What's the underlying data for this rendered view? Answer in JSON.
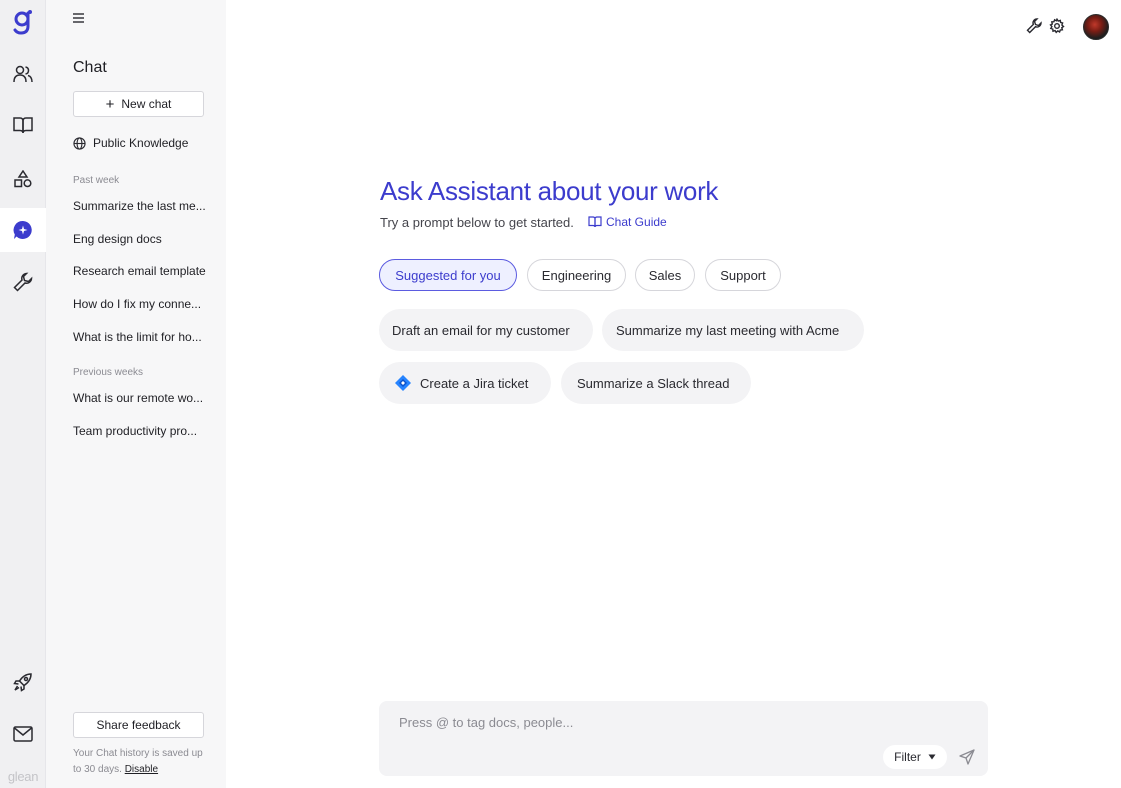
{
  "brand": {
    "wordmark": "glean",
    "accent": "#3c3ccd"
  },
  "rail": {
    "items": [
      {
        "icon": "glean-logo-icon"
      },
      {
        "icon": "people-icon"
      },
      {
        "icon": "book-icon"
      },
      {
        "icon": "shapes-icon"
      },
      {
        "icon": "chat-sparkle-icon",
        "active": true
      },
      {
        "icon": "wrench-icon"
      },
      {
        "icon": "rocket-icon"
      },
      {
        "icon": "mail-icon"
      }
    ]
  },
  "sidebar": {
    "title": "Chat",
    "new_chat_label": "New chat",
    "public_knowledge_label": "Public Knowledge",
    "sections": [
      {
        "label": "Past week",
        "items": [
          "Summarize the last me...",
          "Eng design docs",
          "Research email template",
          "How do I fix my conne...",
          "What is the limit for ho..."
        ]
      },
      {
        "label": "Previous weeks",
        "items": [
          "What is our remote wo...",
          "Team productivity pro..."
        ]
      }
    ],
    "share_feedback_label": "Share feedback",
    "history_note": "Your Chat history is saved up to 30 days.",
    "disable_label": "Disable"
  },
  "main": {
    "title": "Ask Assistant about your work",
    "subtitle": "Try a prompt below to get started.",
    "guide_link": "Chat Guide",
    "tabs": [
      {
        "label": "Suggested for you",
        "active": true
      },
      {
        "label": "Engineering"
      },
      {
        "label": "Sales"
      },
      {
        "label": "Support"
      }
    ],
    "prompts": [
      {
        "label": "Draft an email for my customer"
      },
      {
        "label": "Summarize my last meeting with Acme"
      },
      {
        "label": "Create a Jira ticket",
        "icon": "jira-icon"
      },
      {
        "label": "Summarize a Slack thread"
      }
    ]
  },
  "chat_input": {
    "placeholder": "Press @ to tag docs, people...",
    "value": "",
    "filter_label": "Filter"
  }
}
